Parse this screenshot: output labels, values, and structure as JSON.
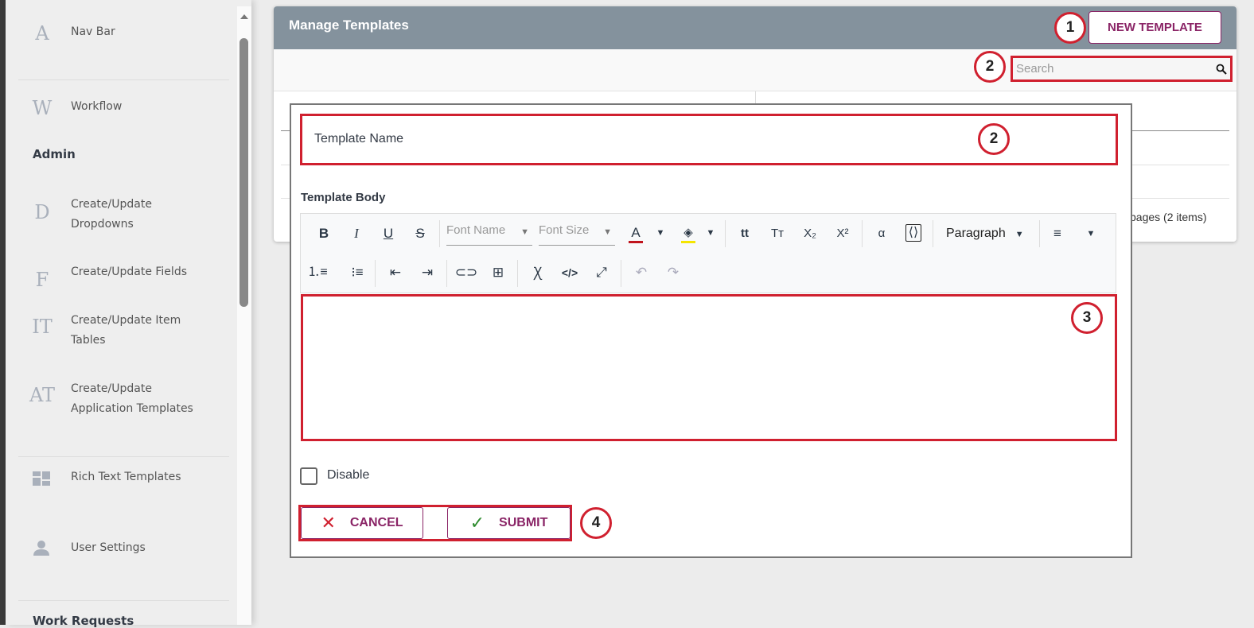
{
  "sidebar": {
    "items": [
      {
        "icon": "A",
        "label": "Nav Bar"
      },
      {
        "icon": "W",
        "label": "Workflow"
      },
      {
        "icon": "D",
        "label": "Create/Update Dropdowns"
      },
      {
        "icon": "F",
        "label": "Create/Update Fields"
      },
      {
        "icon": "IT",
        "label": "Create/Update Item Tables"
      },
      {
        "icon": "AT",
        "label": "Create/Update Application Templates"
      },
      {
        "icon": "dashboard",
        "label": "Rich Text Templates"
      },
      {
        "icon": "person",
        "label": "User Settings"
      }
    ],
    "section_admin": "Admin",
    "section_work": "Work Requests"
  },
  "card": {
    "title": "Manage Templates",
    "new_button": "NEW TEMPLATE",
    "search_placeholder": "Search",
    "pager": "pages (2 items)"
  },
  "modal": {
    "template_name_placeholder": "Template Name",
    "template_body_label": "Template Body",
    "font_name": "Font Name",
    "font_size": "Font Size",
    "paragraph": "Paragraph",
    "disable_label": "Disable",
    "cancel": "CANCEL",
    "submit": "SUBMIT"
  },
  "annotations": [
    "1",
    "2",
    "2",
    "3",
    "4"
  ],
  "colors": {
    "accent": "#8a2466",
    "header": "#84929d",
    "highlight": "#d0202f"
  }
}
